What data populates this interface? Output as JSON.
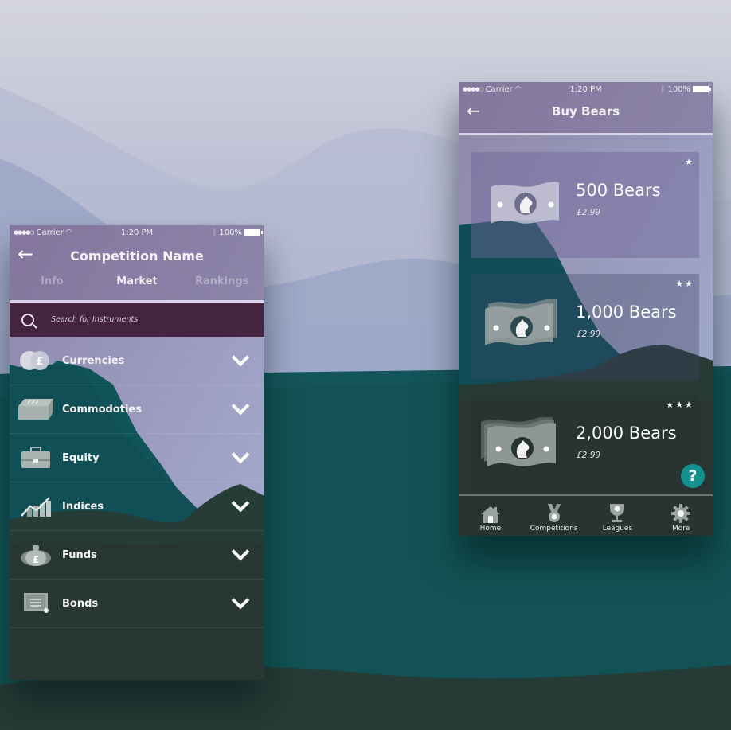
{
  "colors": {
    "search_bar": "#45243f",
    "help_button": "#12928f",
    "tab_bar": "#273430",
    "header_tint": "#786490"
  },
  "left_screen": {
    "status_bar": {
      "signal": "●●●●○",
      "carrier": "Carrier",
      "time": "1:20 PM",
      "battery": "100%"
    },
    "back_icon": "←",
    "title": "Competition Name",
    "tabs": [
      {
        "label": "Info",
        "active": false
      },
      {
        "label": "Market",
        "active": true
      },
      {
        "label": "Rankings",
        "active": false
      }
    ],
    "search": {
      "placeholder": "Search for Instruments",
      "value": ""
    },
    "categories": [
      {
        "label": "Currencies",
        "icon": "coins-icon"
      },
      {
        "label": "Commodoties",
        "icon": "gold-bar-icon"
      },
      {
        "label": "Equity",
        "icon": "briefcase-icon"
      },
      {
        "label": "Indices",
        "icon": "chart-icon"
      },
      {
        "label": "Funds",
        "icon": "money-bag-icon"
      },
      {
        "label": "Bonds",
        "icon": "certificate-icon"
      }
    ]
  },
  "right_screen": {
    "status_bar": {
      "signal": "●●●●○",
      "carrier": "Carrier",
      "time": "1:20 PM",
      "battery": "100%"
    },
    "back_icon": "←",
    "title": "Buy Bears",
    "packages": [
      {
        "title": "500 Bears",
        "price": "£2.99",
        "stars": "★"
      },
      {
        "title": "1,000 Bears",
        "price": "£2.99",
        "stars": "★★"
      },
      {
        "title": "2,000 Bears",
        "price": "£2.99",
        "stars": "★★★"
      }
    ],
    "help_label": "?",
    "tab_bar": [
      {
        "label": "Home",
        "icon": "home-icon"
      },
      {
        "label": "Competitions",
        "icon": "medal-icon"
      },
      {
        "label": "Leagues",
        "icon": "trophy-icon"
      },
      {
        "label": "More",
        "icon": "gear-icon"
      }
    ]
  }
}
